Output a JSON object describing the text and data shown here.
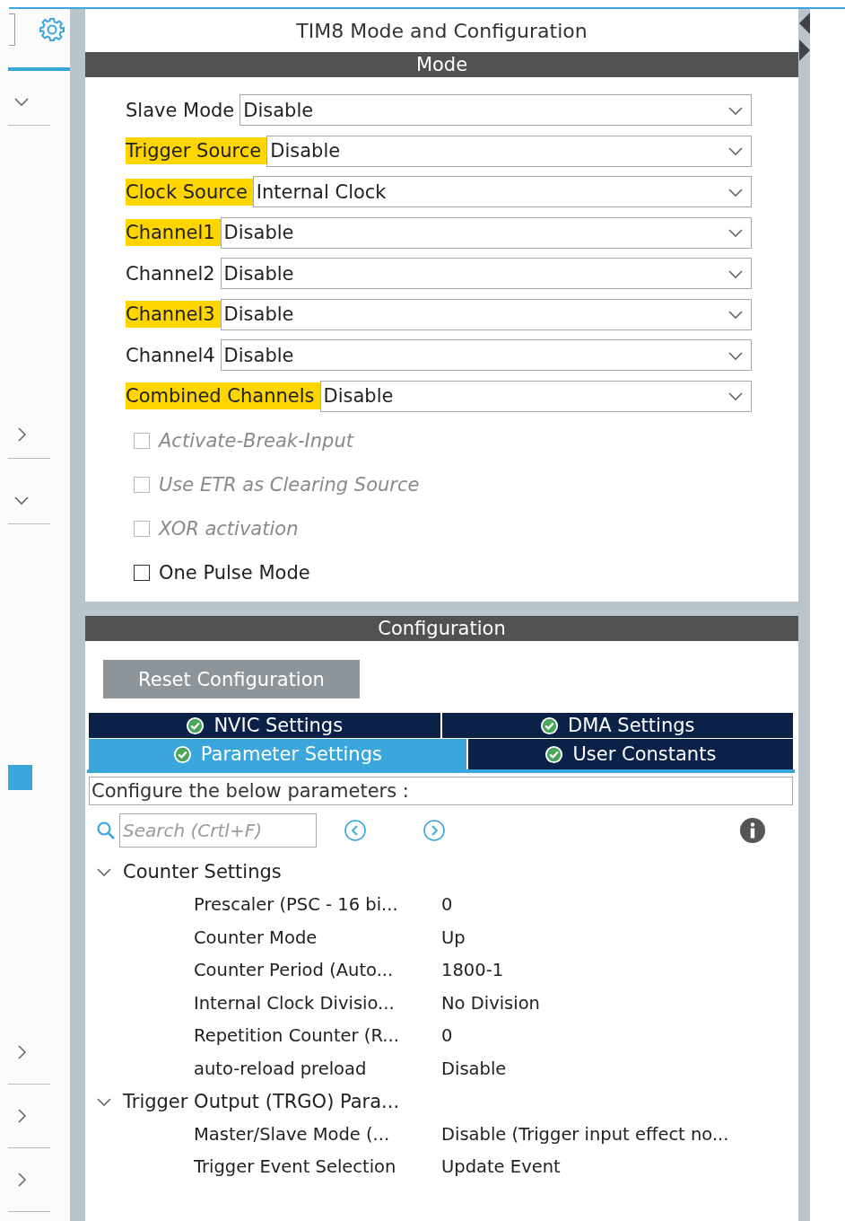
{
  "left_panel": {
    "sections_top": [
      {
        "expanded": true
      },
      {
        "expanded": false
      },
      {
        "expanded": true
      }
    ],
    "sections_bottom": [
      {
        "expanded": false
      },
      {
        "expanded": false
      },
      {
        "expanded": false
      }
    ]
  },
  "title": "TIM8 Mode and Configuration",
  "mode": {
    "header": "Mode",
    "fields": [
      {
        "label": "Slave Mode",
        "value": "Disable",
        "highlighted": false
      },
      {
        "label": "Trigger Source",
        "value": "Disable",
        "highlighted": true
      },
      {
        "label": "Clock Source",
        "value": "Internal Clock",
        "highlighted": true
      },
      {
        "label": "Channel1",
        "value": "Disable",
        "highlighted": true
      },
      {
        "label": "Channel2",
        "value": "Disable",
        "highlighted": false
      },
      {
        "label": "Channel3",
        "value": "Disable",
        "highlighted": true
      },
      {
        "label": "Channel4",
        "value": "Disable",
        "highlighted": false
      },
      {
        "label": "Combined Channels",
        "value": "Disable",
        "highlighted": true
      }
    ],
    "checkboxes": [
      {
        "label": "Activate-Break-Input",
        "checked": false,
        "disabled": true
      },
      {
        "label": "Use ETR as Clearing Source",
        "checked": false,
        "disabled": true
      },
      {
        "label": "XOR activation",
        "checked": false,
        "disabled": true
      },
      {
        "label": "One Pulse Mode",
        "checked": false,
        "disabled": false
      }
    ]
  },
  "configuration": {
    "header": "Configuration",
    "reset_button": "Reset Configuration",
    "tab_rows": [
      [
        {
          "label": "NVIC Settings",
          "selected": false
        },
        {
          "label": "DMA Settings",
          "selected": false
        }
      ],
      [
        {
          "label": "Parameter Settings",
          "selected": true
        },
        {
          "label": "User Constants",
          "selected": false
        }
      ]
    ],
    "description": "Configure the below parameters :",
    "search": {
      "placeholder": "Search (Crtl+F)"
    },
    "groups": [
      {
        "name": "Counter Settings",
        "expanded": true,
        "children": [
          {
            "name": "Prescaler (PSC - 16 bi...",
            "value": "0"
          },
          {
            "name": "Counter Mode",
            "value": "Up"
          },
          {
            "name": "Counter Period (Auto...",
            "value": "1800-1"
          },
          {
            "name": "Internal Clock Divisio...",
            "value": "No Division"
          },
          {
            "name": "Repetition Counter (R...",
            "value": "0"
          },
          {
            "name": "auto-reload preload",
            "value": "Disable"
          }
        ]
      },
      {
        "name": "Trigger Output (TRGO) Para...",
        "expanded": true,
        "children": [
          {
            "name": "Master/Slave Mode (...",
            "value": "Disable (Trigger input effect no..."
          },
          {
            "name": "Trigger Event Selection",
            "value": "Update Event"
          }
        ]
      }
    ]
  }
}
